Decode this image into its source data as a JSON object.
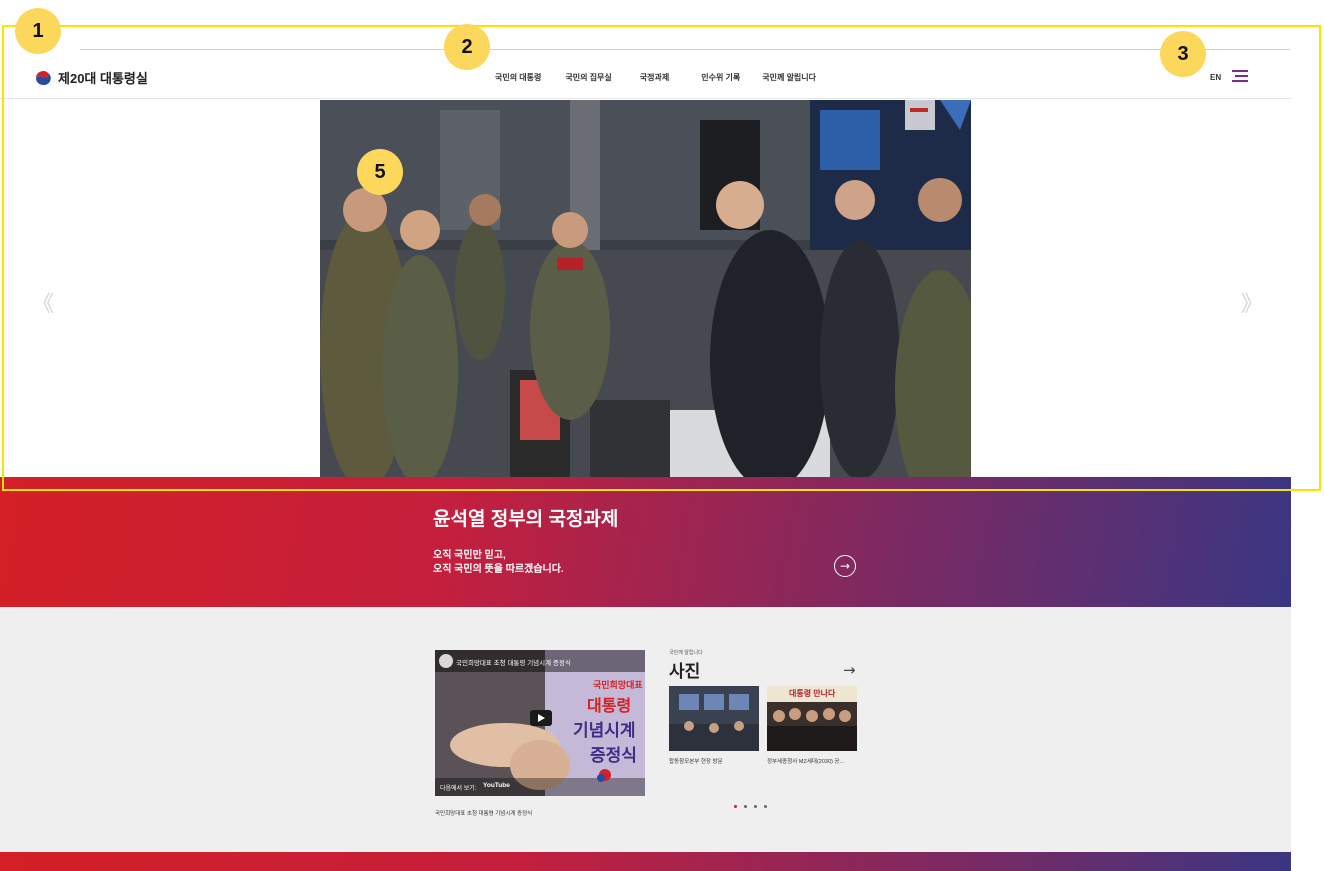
{
  "annotations": {
    "badge1": "1",
    "badge2": "2",
    "badge3": "3",
    "badge5": "5"
  },
  "header": {
    "logo_text": "제20대 대통령실",
    "nav": [
      "국민의 대통령",
      "국민의 집무실",
      "국정과제",
      "인수위 기록",
      "국민께 알립니다"
    ],
    "lang": "EN"
  },
  "hero": {
    "prev": "《",
    "next": "》"
  },
  "policy": {
    "title": "윤석열 정부의 국정과제",
    "line1": "오직 국민만 믿고,",
    "line2": "오직 국민의 뜻을 따르겠습니다.",
    "go": "→"
  },
  "video": {
    "title": "국민희망대표 초청 대통령 기념시계 증정식",
    "kicker": "국민희망대표",
    "big1": "대통령",
    "big2": "기념시계",
    "big3": "증정식",
    "watch_on": "다음에서 보기:",
    "youtube": "YouTube",
    "caption": "국민희망대표 초청 대통령 기념시계 증정식"
  },
  "photos": {
    "kicker": "국민께 알립니다",
    "title": "사진",
    "more": "→",
    "items": [
      {
        "caption": "합동참모본부 현장 방문"
      },
      {
        "caption": "정부세종청사 MZ세대(2030) 공..."
      }
    ],
    "thumb2_overlay": "대통령 만나다"
  },
  "colors": {
    "brand_red": "#d42026",
    "brand_purple": "#3a3683",
    "annotation_yellow": "#f5e600",
    "badge_yellow": "#fbd75b"
  }
}
